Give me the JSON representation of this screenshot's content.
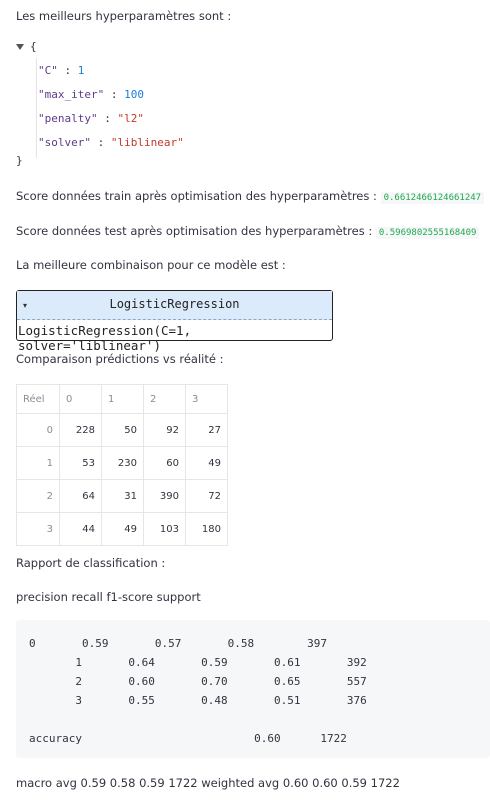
{
  "hyper_title": "Les meilleurs hyperparamètres sont :",
  "json_view": {
    "open_brace": "{",
    "close_brace": "}",
    "params": [
      {
        "key": "\"C\"",
        "value": "1",
        "type": "num"
      },
      {
        "key": "\"max_iter\"",
        "value": "100",
        "type": "num"
      },
      {
        "key": "\"penalty\"",
        "value": "\"l2\"",
        "type": "str"
      },
      {
        "key": "\"solver\"",
        "value": "\"liblinear\"",
        "type": "str"
      }
    ]
  },
  "score_train": {
    "label": "Score données train après optimisation des hyperparamètres :",
    "value": "0.6612466124661247"
  },
  "score_test": {
    "label": "Score données test après optimisation des hyperparamètres :",
    "value": "0.5969802555168409"
  },
  "best_combo_label": "La meilleure combinaison pour ce modèle est :",
  "model": {
    "name": "LogisticRegression",
    "repr": "LogisticRegression(C=1, solver='liblinear')"
  },
  "comparison_label": "Comparaison prédictions vs réalité :",
  "confusion": {
    "index_header": "Réel",
    "columns": [
      "0",
      "1",
      "2",
      "3"
    ],
    "rows": [
      {
        "index": "0",
        "values": [
          "228",
          "50",
          "92",
          "27"
        ]
      },
      {
        "index": "1",
        "values": [
          "53",
          "230",
          "60",
          "49"
        ]
      },
      {
        "index": "2",
        "values": [
          "64",
          "31",
          "390",
          "72"
        ]
      },
      {
        "index": "3",
        "values": [
          "44",
          "49",
          "103",
          "180"
        ]
      }
    ]
  },
  "report_label": "Rapport de classification :",
  "report_header": "precision recall f1-score support",
  "report_block": "0       0.59       0.57       0.58        397\n       1       0.64       0.59       0.61       392\n       2       0.60       0.70       0.65       557\n       3       0.55       0.48       0.51       376\n\naccuracy                          0.60      1722",
  "report_footer": "macro avg 0.59 0.58 0.59 1722 weighted avg 0.60 0.60 0.59 1722"
}
